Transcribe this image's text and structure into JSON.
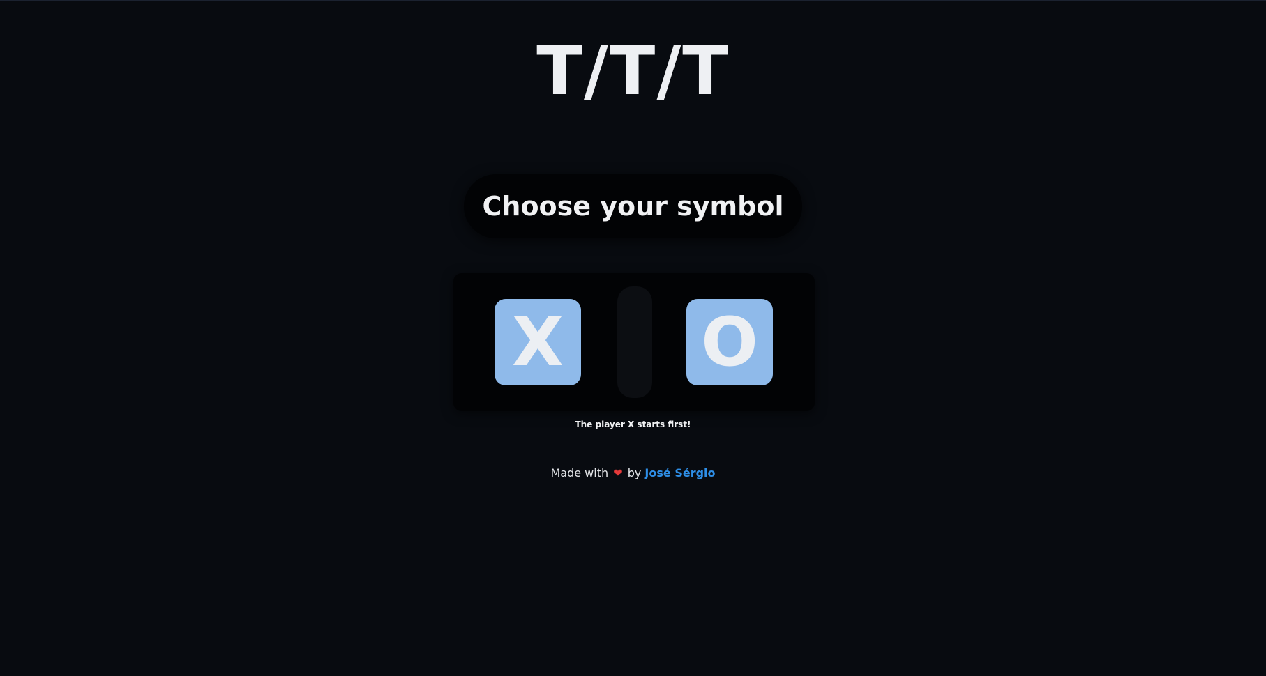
{
  "header": {
    "title": "T/T/T"
  },
  "prompt": {
    "text": "Choose your symbol"
  },
  "symbols": {
    "x_label": "X",
    "o_label": "O",
    "button_color": "#8fbaea"
  },
  "hint": {
    "text": "The player X starts first!"
  },
  "footer": {
    "made_with": "Made with",
    "heart_icon": "heart-icon",
    "heart": "❤",
    "by": "by",
    "author": "José Sérgio",
    "author_color": "#2e8ee6"
  }
}
